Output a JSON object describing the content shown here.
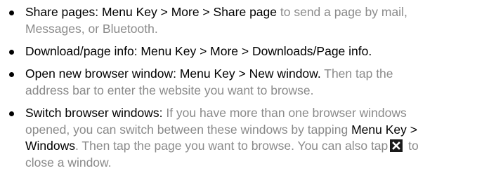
{
  "items": [
    {
      "l1": [
        {
          "t": "Share pages: Menu Key > More > Share page",
          "s": true
        },
        {
          "t": " to send a page by mail,",
          "s": false
        }
      ],
      "l2": [
        {
          "t": "Messages, or Bluetooth.",
          "s": false
        }
      ]
    },
    {
      "l1": [
        {
          "t": "Download/page info: Menu Key > More > Downloads/Page info.",
          "s": true
        }
      ]
    },
    {
      "l1": [
        {
          "t": "Open new browser window: Menu Key > New window.",
          "s": true
        },
        {
          "t": " Then tap the",
          "s": false
        }
      ],
      "l2": [
        {
          "t": "address bar to enter the website you want to browse.",
          "s": false
        }
      ]
    },
    {
      "l1": [
        {
          "t": "Switch browser windows:",
          "s": true
        },
        {
          "t": " If you have more than one browser windows",
          "s": false
        }
      ],
      "l2": [
        {
          "t": "opened, you can switch between these windows by tapping ",
          "s": false
        },
        {
          "t": "Menu Key >",
          "s": true
        }
      ],
      "l3": [
        {
          "t": "Windows",
          "s": true
        },
        {
          "t": ". Then tap the page you want to browse. You can also tap",
          "s": false
        }
      ],
      "l3_after_icon": [
        {
          "t": " to",
          "s": false
        }
      ],
      "l4": [
        {
          "t": "close a window.",
          "s": false
        }
      ],
      "icon": "close-icon"
    }
  ]
}
